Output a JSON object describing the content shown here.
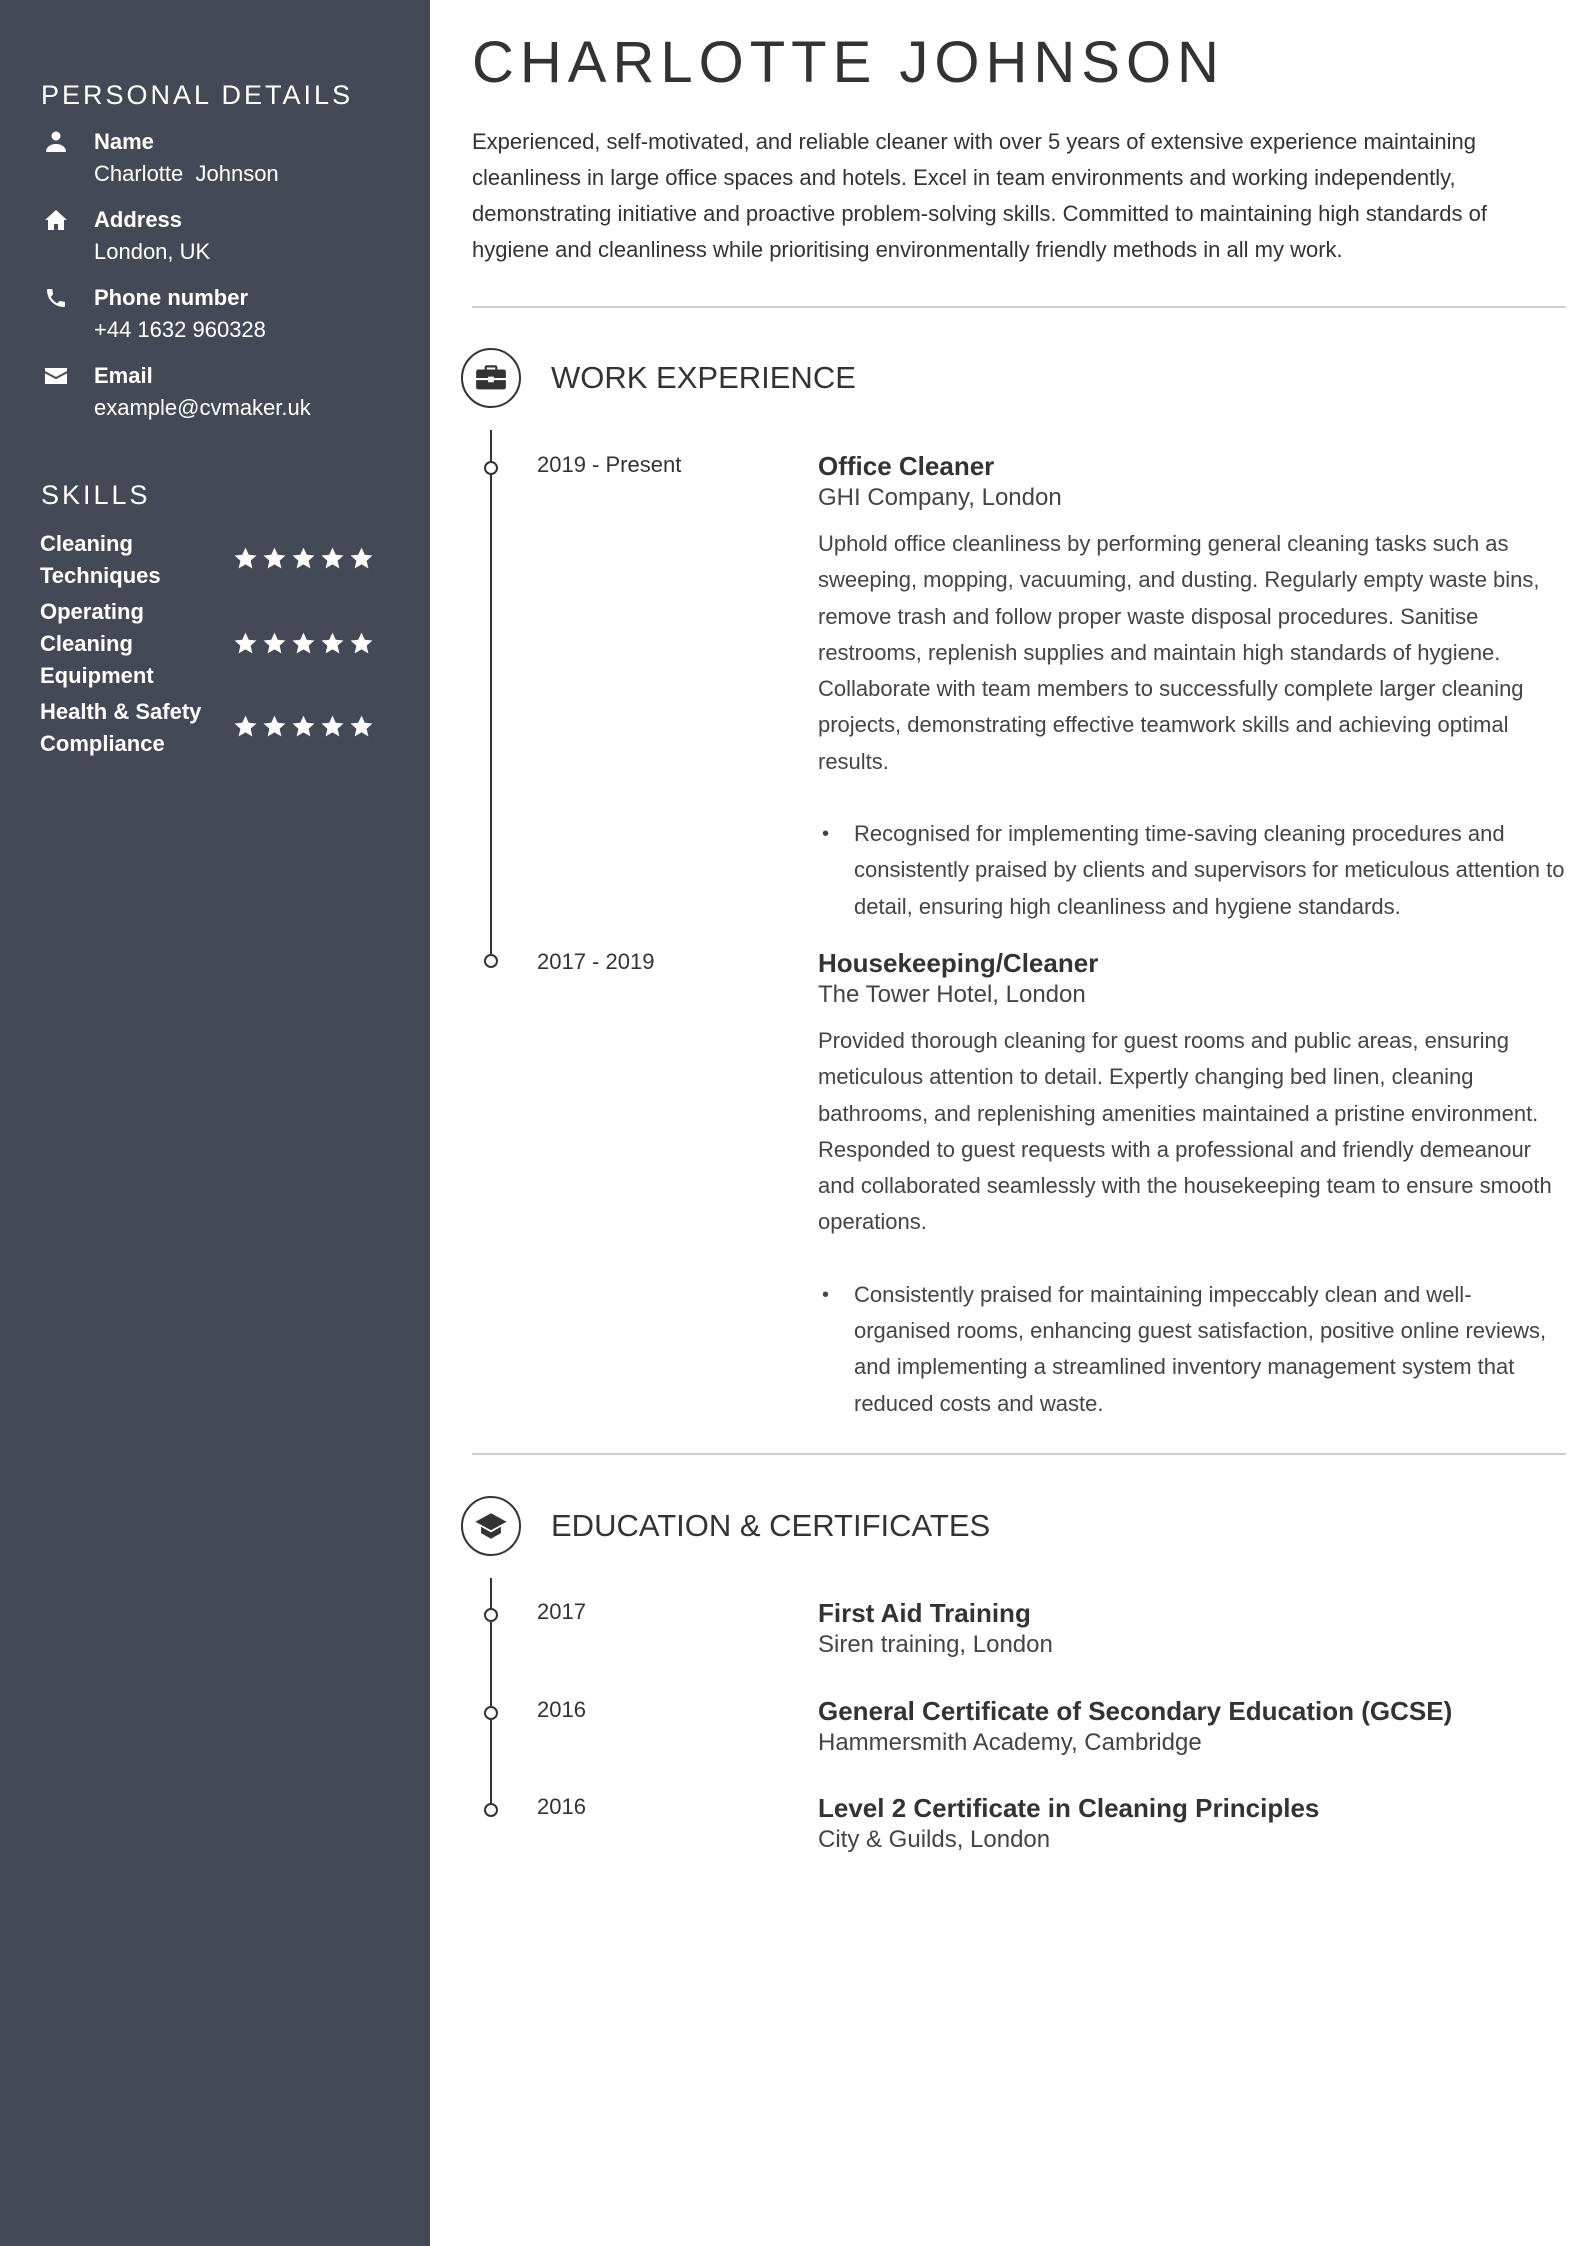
{
  "sidebar": {
    "personal_heading": "PERSONAL DETAILS",
    "details": [
      {
        "icon": "person-icon",
        "label": "Name",
        "value": "Charlotte  Johnson"
      },
      {
        "icon": "home-icon",
        "label": "Address",
        "value": "London, UK"
      },
      {
        "icon": "phone-icon",
        "label": "Phone number",
        "value": "+44 1632 960328"
      },
      {
        "icon": "envelope-icon",
        "label": "Email",
        "value": "example@cvmaker.uk"
      }
    ],
    "skills_heading": "SKILLS",
    "skills": [
      {
        "label": "Cleaning Techniques",
        "rating": 5,
        "max": 5
      },
      {
        "label": "Operating Cleaning Equipment",
        "rating": 5,
        "max": 5
      },
      {
        "label": "Health & Safety Compliance",
        "rating": 5,
        "max": 5
      }
    ]
  },
  "header": {
    "name": "CHARLOTTE JOHNSON",
    "summary": "Experienced, self-motivated, and reliable cleaner with over 5 years of extensive experience maintaining cleanliness in large office spaces and hotels. Excel in team environments and working independently, demonstrating initiative and proactive problem-solving skills. Committed to maintaining high standards of hygiene and cleanliness while prioritising environmentally friendly methods in all my work."
  },
  "work": {
    "heading": "WORK EXPERIENCE",
    "icon": "briefcase-icon",
    "entries": [
      {
        "date": "2019 - Present",
        "title": "Office Cleaner",
        "org": "GHI Company, London",
        "description": "Uphold office cleanliness by performing general cleaning tasks such as sweeping, mopping, vacuuming, and dusting. Regularly empty waste bins, remove trash and follow proper waste disposal procedures. Sanitise restrooms, replenish supplies and maintain high standards of hygiene. Collaborate with team members to successfully complete larger cleaning projects, demonstrating effective teamwork skills and achieving optimal results.",
        "bullets": [
          "Recognised for implementing time-saving cleaning procedures and consistently praised by clients and supervisors for meticulous attention to detail, ensuring high cleanliness and hygiene standards."
        ]
      },
      {
        "date": "2017 - 2019",
        "title": "Housekeeping/Cleaner",
        "org": "The Tower Hotel, London",
        "description": "Provided thorough cleaning for guest rooms and public areas, ensuring meticulous attention to detail. Expertly changing bed linen, cleaning bathrooms, and replenishing amenities maintained a pristine environment. Responded to guest requests with a professional and friendly demeanour and collaborated seamlessly with the housekeeping team to ensure smooth operations.",
        "bullets": [
          "Consistently praised for maintaining impeccably clean and well-organised rooms, enhancing guest satisfaction, positive online reviews, and implementing a streamlined inventory management system that reduced costs and waste."
        ]
      }
    ]
  },
  "education": {
    "heading": "EDUCATION & CERTIFICATES",
    "icon": "graduation-cap-icon",
    "entries": [
      {
        "date": "2017",
        "title": "First Aid Training",
        "org": "Siren training, London"
      },
      {
        "date": "2016",
        "title": "General Certificate of Secondary Education (GCSE)",
        "org": "Hammersmith Academy, Cambridge"
      },
      {
        "date": "2016",
        "title": "Level 2 Certificate in Cleaning Principles",
        "org": "City & Guilds, London"
      }
    ]
  },
  "colors": {
    "sidebar_bg": "#444a55",
    "text": "#333333",
    "divider": "#cfcfcf"
  }
}
